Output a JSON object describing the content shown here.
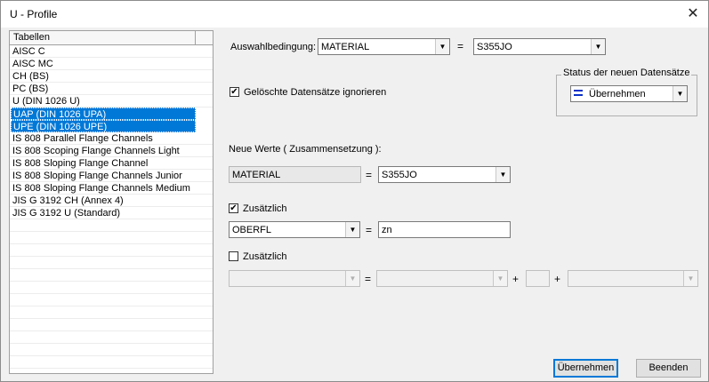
{
  "window": {
    "title": "U - Profile"
  },
  "list": {
    "header": "Tabellen",
    "items": [
      {
        "label": "AISC C",
        "selected": false
      },
      {
        "label": "AISC MC",
        "selected": false
      },
      {
        "label": "CH (BS)",
        "selected": false
      },
      {
        "label": "PC (BS)",
        "selected": false
      },
      {
        "label": "U (DIN 1026 U)",
        "selected": false
      },
      {
        "label": "UAP (DIN 1026 UPA)",
        "selected": true
      },
      {
        "label": "UPE (DIN 1026 UPE)",
        "selected": true
      },
      {
        "label": "IS 808 Parallel Flange Channels",
        "selected": false
      },
      {
        "label": "IS 808 Scoping Flange Channels Light",
        "selected": false
      },
      {
        "label": "IS 808 Sloping Flange Channel",
        "selected": false
      },
      {
        "label": "IS 808 Sloping Flange Channels Junior",
        "selected": false
      },
      {
        "label": "IS 808 Sloping Flange Channels Medium",
        "selected": false
      },
      {
        "label": "JIS G 3192 CH (Annex 4)",
        "selected": false
      },
      {
        "label": "JIS G 3192 U (Standard)",
        "selected": false
      }
    ]
  },
  "condition": {
    "label": "Auswahlbedingung:",
    "field": "MATERIAL",
    "equals": "=",
    "value": "S355JO"
  },
  "ignore_deleted": {
    "label": "Gelöschte Datensätze ignorieren",
    "checked": true
  },
  "status": {
    "title": "Status der neuen Datensätze",
    "value": "Übernehmen",
    "icon": "equals-icon"
  },
  "new_values": {
    "label": "Neue Werte ( Zusammensetzung ):",
    "field": "MATERIAL",
    "equals": "=",
    "value": "S355JO"
  },
  "additional1": {
    "label": "Zusätzlich",
    "checked": true,
    "field": "OBERFL",
    "equals": "=",
    "value": "zn"
  },
  "additional2": {
    "label": "Zusätzlich",
    "checked": false,
    "field": "",
    "equals": "=",
    "value": "",
    "plus1": "+",
    "middle": "",
    "plus2": "+",
    "last": ""
  },
  "buttons": {
    "apply": "Übernehmen",
    "close": "Beenden"
  },
  "close_glyph": "✕",
  "check_glyph": "✔",
  "arrow_glyph": "▼"
}
